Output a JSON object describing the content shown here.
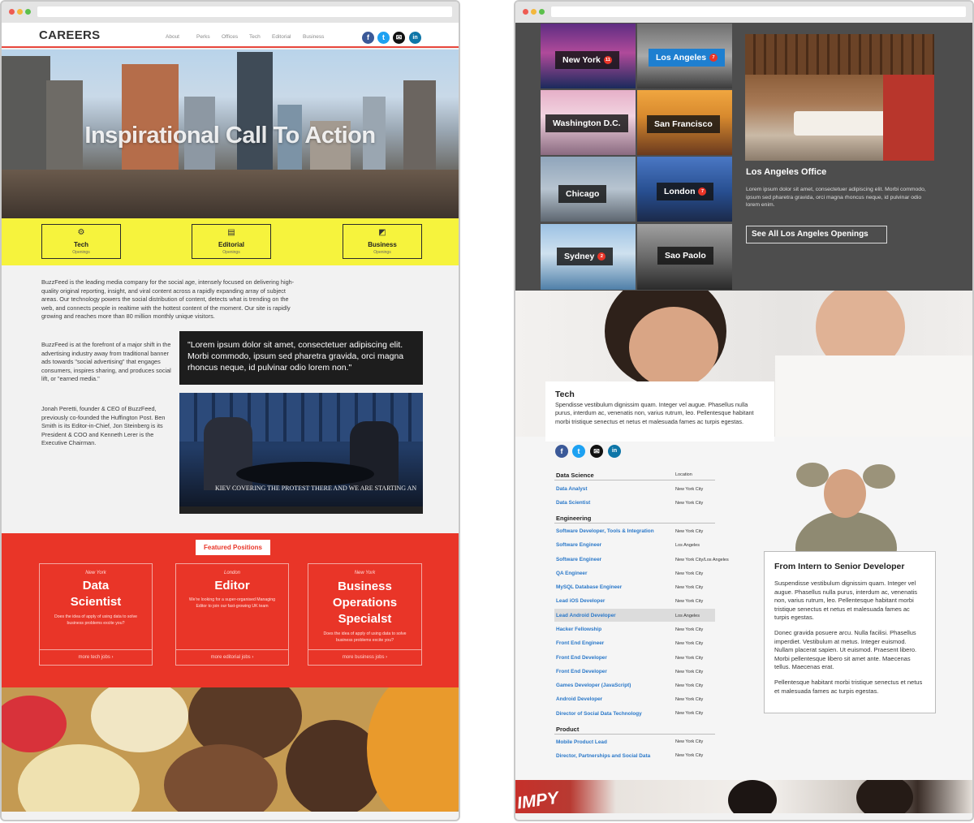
{
  "careers": {
    "logo": "CAREERS",
    "nav": [
      "About",
      "Perks",
      "Offices",
      "Tech",
      "Editorial",
      "Business"
    ],
    "social": [
      {
        "icon": "facebook-icon",
        "glyph": "f",
        "color": "#3b5998"
      },
      {
        "icon": "twitter-icon",
        "glyph": "t",
        "color": "#1da1f2"
      },
      {
        "icon": "email-icon",
        "glyph": "✉",
        "color": "#111111"
      },
      {
        "icon": "linkedin-icon",
        "glyph": "in",
        "color": "#0e76a8"
      }
    ],
    "hero_title": "Inspirational Call To Action",
    "categories": [
      {
        "label": "Tech",
        "sub": "Openings",
        "icon": "gear-icon"
      },
      {
        "label": "Editorial",
        "sub": "Openings",
        "icon": "document-icon"
      },
      {
        "label": "Business",
        "sub": "Openings",
        "icon": "chart-icon"
      }
    ],
    "intro_p1": "BuzzFeed is the leading media company for the social age, intensely focused on delivering high-quality original reporting, insight, and viral content across a rapidly expanding array of subject areas. Our technology powers the social distribution of content, detects what is trending on the web, and connects people in realtime with the hottest content of the moment. Our site is rapidly growing and reaches more than 80 million monthly unique visitors.",
    "intro_p2": "BuzzFeed is at the forefront of a major shift in the advertising industry away from traditional banner ads towards \"social advertising\" that engages consumers, inspires sharing, and produces social lift, or \"earned media.\"",
    "intro_p3": "Jonah Peretti, founder & CEO of BuzzFeed, previously co-founded the Huffington Post. Ben Smith is its Editor-in-Chief, Jon Steinberg is its President & COO and Kenneth Lerer is the Executive Chairman.",
    "quote": "\"Lorem ipsum dolor sit amet, consectetuer adipiscing elit. Morbi commodo, ipsum sed pharetra gravida, orci magna rhoncus neque, id pulvinar odio lorem non.\"",
    "video_caption": "KIEV COVERING THE PROTEST THERE AND WE ARE STARTING AN",
    "featured_label": "Featured Positions",
    "featured": [
      {
        "location": "New York",
        "title": "Data Scientist",
        "desc": "Does the idea of apply of using data to solve business problems excite you?",
        "more": "more tech jobs ›"
      },
      {
        "location": "London",
        "title": "Editor",
        "desc": "We're looking for a super-organised Managing Editor to join our fast-growing UK team",
        "more": "more editorial jobs ›"
      },
      {
        "location": "New York",
        "title": "Business Operations Specialst",
        "desc": "Does the idea of apply of using data to solve business problems excite you?",
        "more": "more business jobs ›"
      }
    ]
  },
  "offices": {
    "cities": [
      {
        "name": "New York",
        "badge": "11"
      },
      {
        "name": "Los Angeles",
        "badge": "7"
      },
      {
        "name": "Washington D.C.",
        "badge": ""
      },
      {
        "name": "San Francisco",
        "badge": ""
      },
      {
        "name": "Chicago",
        "badge": ""
      },
      {
        "name": "London",
        "badge": "7"
      },
      {
        "name": "Sydney",
        "badge": "2"
      },
      {
        "name": "Sao Paolo",
        "badge": ""
      }
    ],
    "office_title": "Los Angeles Office",
    "office_desc": "Lorem ipsum dolor sit amet, consectetuer adipiscing elit. Morbi commodo, ipsum sed pharetra gravida, orci magna rhoncus neque, id pulvinar odio lorem enim.",
    "see_all": "See All Los Angeles Openings",
    "tech_title": "Tech",
    "tech_desc": "Spendisse vestibulum dignissim quam. Integer vel augue. Phasellus nulla purus, interdum ac, venenatis non, varius rutrum, leo. Pellentesque habitant morbi tristique senectus et netus et malesuada fames ac turpis egestas.",
    "location_header": "Location",
    "groups": [
      {
        "name": "Data Science",
        "jobs": [
          {
            "title": "Data Analyst",
            "loc": "New York City"
          },
          {
            "title": "Data Scientist",
            "loc": "New York City"
          }
        ]
      },
      {
        "name": "Engineering",
        "jobs": [
          {
            "title": "Software Developer, Tools & Integration",
            "loc": "New York City"
          },
          {
            "title": "Software Engineer",
            "loc": "Los Angeles"
          },
          {
            "title": "Software Engineer",
            "loc": "New York City/Los Angeles"
          },
          {
            "title": "QA Engineer",
            "loc": "New York City"
          },
          {
            "title": "MySQL Database Engineer",
            "loc": "New York City"
          },
          {
            "title": "Lead iOS Developer",
            "loc": "New York City"
          },
          {
            "title": "Lead Android Developer",
            "loc": "Los Angeles"
          },
          {
            "title": "Hacker Fellowship",
            "loc": "New York City"
          },
          {
            "title": "Front End Engineer",
            "loc": "New York City"
          },
          {
            "title": "Front End Developer",
            "loc": "New York City"
          },
          {
            "title": "Front End Developer",
            "loc": "New York City"
          },
          {
            "title": "Games Developer (JavaScript)",
            "loc": "New York City"
          },
          {
            "title": "Android Developer",
            "loc": "New York City"
          },
          {
            "title": "Director of Social Data Technology",
            "loc": "New York City"
          }
        ]
      },
      {
        "name": "Product",
        "jobs": [
          {
            "title": "Mobile Product Lead",
            "loc": "New York City"
          },
          {
            "title": "Director, Partnerships and Social Data",
            "loc": "New York City"
          }
        ]
      }
    ],
    "highlighted_job": "Lead Android Developer",
    "story_title": "From Intern to Senior Developer",
    "story_p1": "Suspendisse vestibulum dignissim quam. Integer vel augue. Phasellus nulla purus, interdum ac, venenatis non, varius rutrum, leo. Pellentesque habitant morbi tristique senectus et netus et malesuada fames ac turpis egestas.",
    "story_p2": "Donec gravida posuere arcu. Nulla facilisi. Phasellus imperdiet. Vestibulum at metus. Integer euismod. Nullam placerat sapien. Ut euismod. Praesent libero. Morbi pellentesque libero sit amet ante. Maecenas tellus. Maecenas erat.",
    "story_p3": "Pellentesque habitant morbi tristique senectus et netus et malesuada fames ac turpis egestas.",
    "bottom_sign": "IMPY"
  },
  "colors": {
    "accent_red": "#e93528",
    "accent_yellow": "#f6f33d",
    "link_blue": "#2a78c9",
    "dark_panel": "#4d4d4d"
  }
}
